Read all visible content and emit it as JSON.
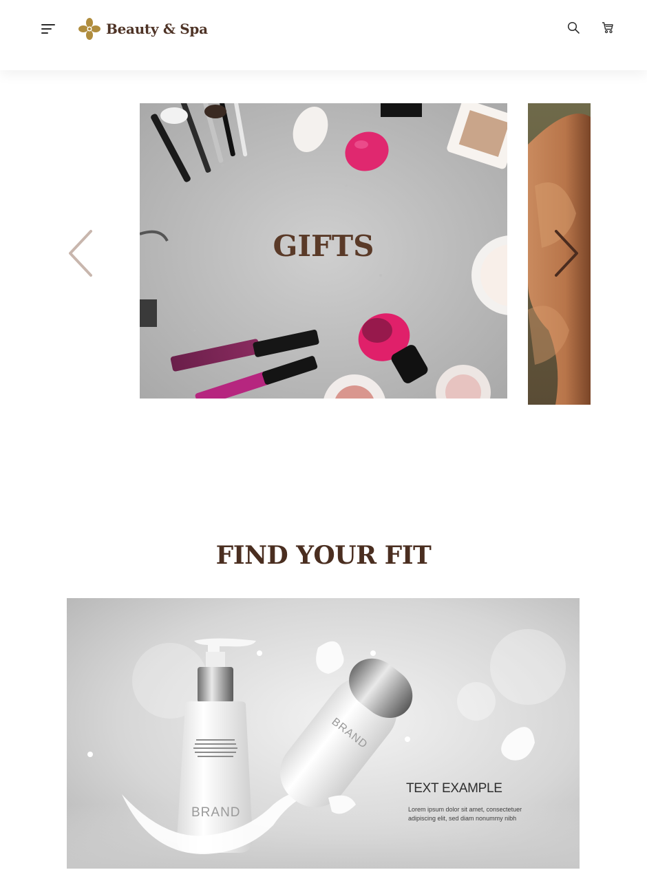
{
  "header": {
    "brand": "Beauty & Spa",
    "menu_icon": "hamburger-menu-icon",
    "search_icon": "search-icon",
    "cart_icon": "cart-icon"
  },
  "carousel": {
    "slides": [
      {
        "title": "GIFTS",
        "image": "makeup-flatlay"
      },
      {
        "title": "",
        "image": "muscular-arm"
      }
    ],
    "prev_icon": "chevron-left-icon",
    "next_icon": "chevron-right-icon"
  },
  "fit_section": {
    "title": "FIND YOUR FIT",
    "banner": {
      "headline": "TEXT EXAMPLE",
      "body": "Lorem ipsum dolor sit amet, consectetuer adipiscing elit, sed diam nonummy nibh",
      "bottle_brand": "BRAND",
      "tube_brand": "BRAND",
      "bottle_fine_print": "Lorem ipsum dolor sit amet, consectetur adipiscing elit, sed do eiusmod tempor incididunt ut labore et dolore magna aliqua."
    }
  },
  "colors": {
    "brand_brown": "#4e3326",
    "title_brown": "#5a3a28",
    "logo_gold": "#b08d3e"
  }
}
